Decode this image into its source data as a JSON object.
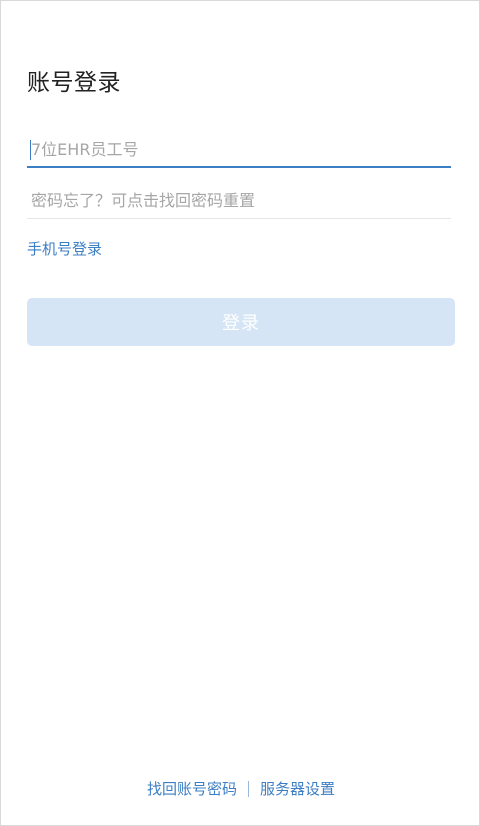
{
  "header": {
    "title": "账号登录"
  },
  "form": {
    "account_placeholder": "7位EHR员工号",
    "account_value": "",
    "password_placeholder": "密码忘了？可点击找回密码重置",
    "password_value": "",
    "phone_login_label": "手机号登录",
    "submit_label": "登录"
  },
  "footer": {
    "recover_account_label": "找回账号密码",
    "server_settings_label": "服务器设置"
  },
  "colors": {
    "accent": "#3d7fc4",
    "button_disabled_bg": "#d6e5f6",
    "placeholder": "#a6a6a6",
    "title": "#222222"
  }
}
